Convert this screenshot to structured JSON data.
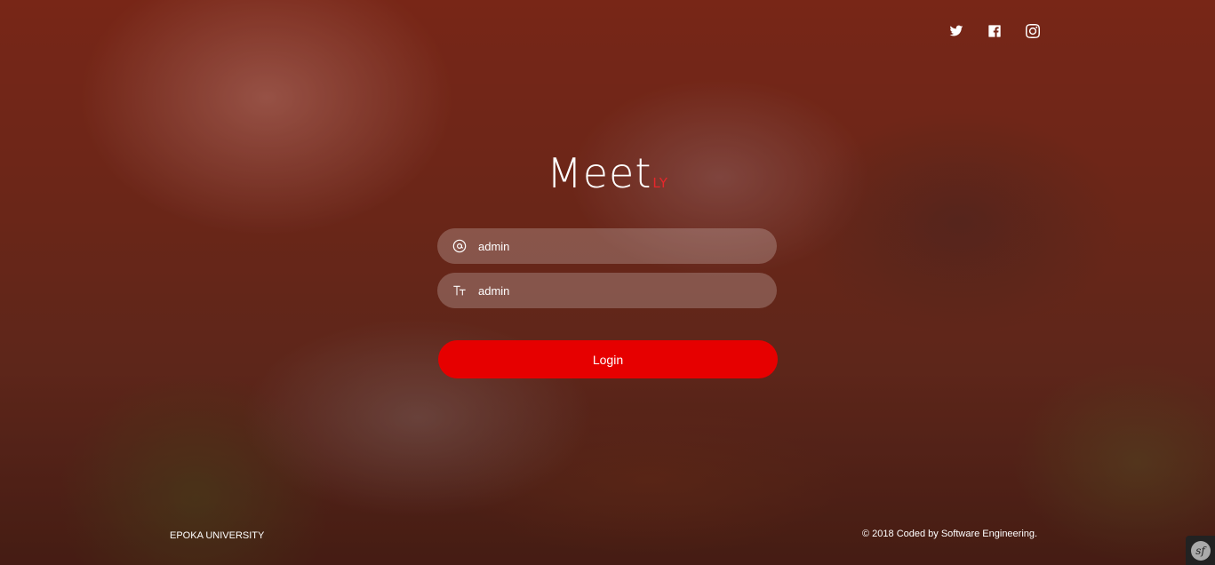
{
  "social": {
    "icons": [
      "twitter-icon",
      "facebook-icon",
      "instagram-icon"
    ]
  },
  "logo": {
    "main": "Meet",
    "suffix": "LY",
    "suffix_color": "#e8262b"
  },
  "form": {
    "username_value": "admin",
    "password_value": "admin",
    "login_label": "Login",
    "button_color": "#e60000"
  },
  "footer": {
    "left_text": "EPOKA UNIVERSITY",
    "right_text": "© 2018 Coded by Software Engineering."
  },
  "debug_toolbar": {
    "label": "sf"
  }
}
